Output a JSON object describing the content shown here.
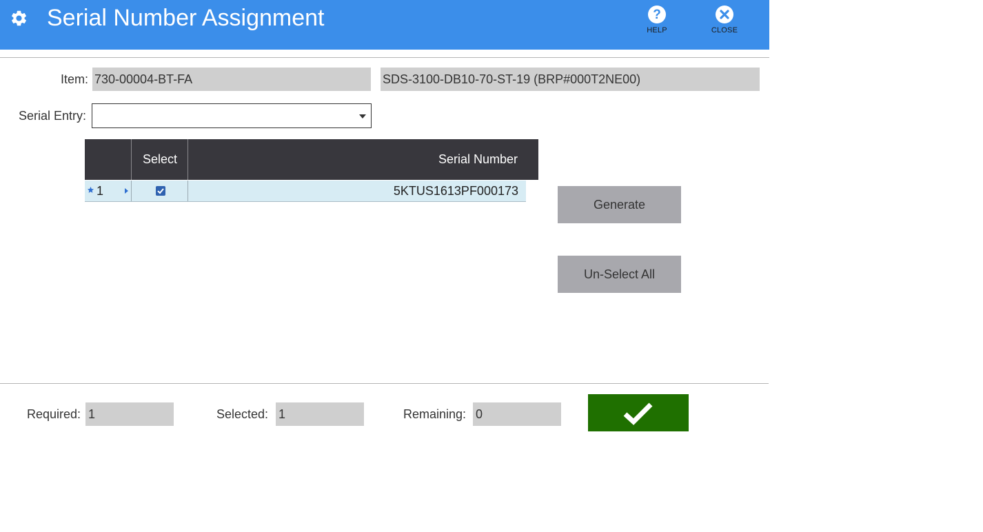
{
  "header": {
    "title": "Serial Number Assignment",
    "help_label": "HELP",
    "close_label": "CLOSE",
    "color": "#3b8eea",
    "icons": [
      "gear-icon",
      "help-icon",
      "close-icon"
    ]
  },
  "form": {
    "item_label": "Item:",
    "item_value": "730-00004-BT-FA",
    "item_description": "SDS-3100-DB10-70-ST-19 (BRP#000T2NE00)",
    "serial_entry_label": "Serial Entry:",
    "serial_entry_value": ""
  },
  "grid": {
    "columns": [
      "",
      "Select",
      "Serial Number"
    ],
    "rows": [
      {
        "row_number": "1",
        "selected": true,
        "serial_number": "5KTUS1613PF000173"
      }
    ]
  },
  "actions": {
    "generate_label": "Generate",
    "unselect_all_label": "Un-Select All"
  },
  "footer": {
    "required_label": "Required:",
    "required_value": "1",
    "selected_label": "Selected:",
    "selected_value": "1",
    "remaining_label": "Remaining:",
    "remaining_value": "0",
    "confirm_color": "#1f7000"
  }
}
